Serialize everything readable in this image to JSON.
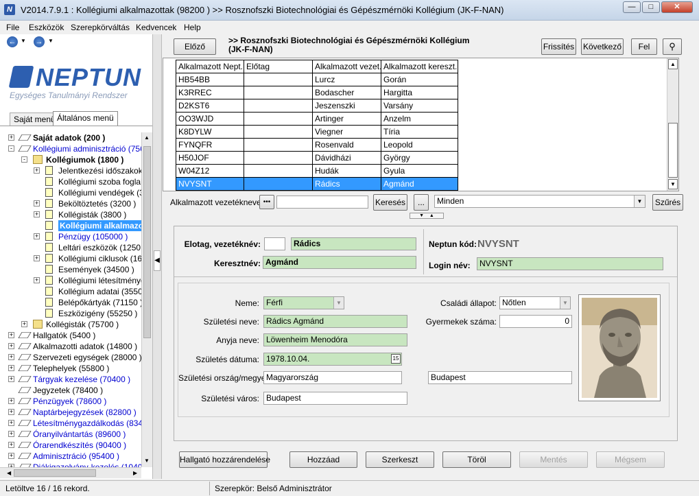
{
  "window": {
    "title": "V2014.7.9.1 : Kollégiumi alkalmazottak (98200  )  >> Rosznofszki Biotechnológiai és Gépészmérnöki Kollégium (JK-F-NAN)",
    "app_icon": "N"
  },
  "menu": [
    "File",
    "Eszközök",
    "Szerepkörváltás",
    "Kedvencek",
    "Help"
  ],
  "logo": {
    "brand": "NEPTUN",
    "subtitle": "Egységes Tanulmányi Rendszer"
  },
  "left_tabs": [
    "Saját menü",
    "Általános menü"
  ],
  "tree": [
    {
      "label": "Saját adatok (200  )",
      "level": 0,
      "icon": "diamond",
      "pm": "+",
      "style": "bold"
    },
    {
      "label": "Kollégiumi adminisztráció (75650",
      "level": 0,
      "icon": "diamond",
      "pm": "-",
      "style": "blue"
    },
    {
      "label": "Kollégiumok (1800  )",
      "level": 1,
      "icon": "folder",
      "pm": "-",
      "style": "bold"
    },
    {
      "label": "Jelentkezési időszakok (2",
      "level": 2,
      "icon": "page",
      "pm": "+",
      "style": ""
    },
    {
      "label": "Kollégiumi szoba foglaltsá",
      "level": 2,
      "icon": "page",
      "pm": "",
      "style": ""
    },
    {
      "label": "Kollégiumi vendégek (315",
      "level": 2,
      "icon": "page",
      "pm": "",
      "style": ""
    },
    {
      "label": "Beköltöztetés (3200  )",
      "level": 2,
      "icon": "page",
      "pm": "+",
      "style": ""
    },
    {
      "label": "Kollégisták (3800  )",
      "level": 2,
      "icon": "page",
      "pm": "+",
      "style": ""
    },
    {
      "label": "Kollégiumi alkalmazot",
      "level": 2,
      "icon": "page",
      "pm": "",
      "style": "selected"
    },
    {
      "label": "Pénzügy (105000  )",
      "level": 2,
      "icon": "page",
      "pm": "+",
      "style": "blue"
    },
    {
      "label": "Leltári eszközök (1250  )",
      "level": 2,
      "icon": "page",
      "pm": "",
      "style": ""
    },
    {
      "label": "Kollégiumi ciklusok (1610",
      "level": 2,
      "icon": "page",
      "pm": "+",
      "style": ""
    },
    {
      "label": "Események (34500  )",
      "level": 2,
      "icon": "page",
      "pm": "",
      "style": ""
    },
    {
      "label": "Kollégiumi létesítménygaz",
      "level": 2,
      "icon": "page",
      "pm": "+",
      "style": ""
    },
    {
      "label": "Kollégium adatai (3550  )",
      "level": 2,
      "icon": "page",
      "pm": "",
      "style": ""
    },
    {
      "label": "Belépőkártyák (71150  )",
      "level": 2,
      "icon": "page",
      "pm": "",
      "style": ""
    },
    {
      "label": "Eszközigény (55250  )",
      "level": 2,
      "icon": "page",
      "pm": "",
      "style": ""
    },
    {
      "label": "Kollégisták (75700  )",
      "level": 1,
      "icon": "folder",
      "pm": "+",
      "style": ""
    },
    {
      "label": "Hallgatók (5400  )",
      "level": 0,
      "icon": "diamond",
      "pm": "+",
      "style": ""
    },
    {
      "label": "Alkalmazotti adatok (14800  )",
      "level": 0,
      "icon": "diamond",
      "pm": "+",
      "style": ""
    },
    {
      "label": "Szervezeti egységek (28000  )",
      "level": 0,
      "icon": "diamond",
      "pm": "+",
      "style": ""
    },
    {
      "label": "Telephelyek (55800  )",
      "level": 0,
      "icon": "diamond",
      "pm": "+",
      "style": ""
    },
    {
      "label": "Tárgyak kezelése (70400  )",
      "level": 0,
      "icon": "diamond",
      "pm": "+",
      "style": "blue"
    },
    {
      "label": "Jegyzetek (78400  )",
      "level": 0,
      "icon": "diamond",
      "pm": "",
      "style": ""
    },
    {
      "label": "Pénzügyek (78600  )",
      "level": 0,
      "icon": "diamond",
      "pm": "+",
      "style": "blue"
    },
    {
      "label": "Naptárbejegyzések (82800  )",
      "level": 0,
      "icon": "diamond",
      "pm": "+",
      "style": "blue"
    },
    {
      "label": "Létesítménygazdálkodás (83400",
      "level": 0,
      "icon": "diamond",
      "pm": "+",
      "style": "blue"
    },
    {
      "label": "Óranyilvántartás (89600  )",
      "level": 0,
      "icon": "diamond",
      "pm": "+",
      "style": "blue"
    },
    {
      "label": "Órarendkészítés (90400  )",
      "level": 0,
      "icon": "diamond",
      "pm": "+",
      "style": "blue"
    },
    {
      "label": "Adminisztráció (95400  )",
      "level": 0,
      "icon": "diamond",
      "pm": "+",
      "style": "blue"
    },
    {
      "label": "Diákigazolvány-kezelés (10400...",
      "level": 0,
      "icon": "diamond",
      "pm": "+",
      "style": "blue"
    }
  ],
  "toolbar": {
    "prev": "Előző",
    "header_title": ">> Rosznofszki Biotechnológiai és Gépészmérnöki Kollégium (JK-F-NAN)",
    "refresh": "Frissítés",
    "next": "Következő",
    "up": "Fel"
  },
  "grid": {
    "columns": [
      "Alkalmazott Nept...",
      "Előtag",
      "Alkalmazott vezet...",
      "Alkalmazott kereszt..."
    ],
    "rows": [
      [
        "HB54BB",
        "",
        "Lurcz",
        "Gorán"
      ],
      [
        "K3RREC",
        "",
        "Bodascher",
        "Hargitta"
      ],
      [
        "D2KST6",
        "",
        "Jeszenszki",
        "Varsány"
      ],
      [
        "OO3WJD",
        "",
        "Artinger",
        "Anzelm"
      ],
      [
        "K8DYLW",
        "",
        "Viegner",
        "Tíria"
      ],
      [
        "FYNQFR",
        "",
        "Rosenvald",
        "Leopold"
      ],
      [
        "H50JOF",
        "",
        "Dávidházi",
        "György"
      ],
      [
        "W04Z12",
        "",
        "Hudák",
        "Gyula"
      ],
      [
        "NVYSNT",
        "",
        "Rádics",
        "Agmánd"
      ]
    ],
    "selected_index": 8
  },
  "search": {
    "label": "Alkalmazott vezetékneve",
    "dots": "•••",
    "value": "",
    "search_btn": "Keresés",
    "ellipsis": "...",
    "filter_value": "Minden",
    "filter_btn": "Szűrés"
  },
  "detail": {
    "prefix_label": "Elotag, vezetéknév:",
    "prefix_value": "",
    "lastname": "Rádics",
    "firstname_label": "Keresztnév:",
    "firstname": "Agmánd",
    "neptun_label": "Neptun kód:",
    "neptun_value": "NVYSNT",
    "login_label": "Login név:",
    "login_value": "NVYSNT",
    "gender_label": "Neme:",
    "gender_value": "Férfi",
    "birthname_label": "Születési neve:",
    "birthname_value": "Rádics Agmánd",
    "mother_label": "Anyja neve:",
    "mother_value": "Löwenheim Menodóra",
    "birthdate_label": "Születés dátuma:",
    "birthdate_value": "1978.10.04.",
    "calendar_day": "15",
    "country_label": "Születési ország/megye:",
    "country_value": "Magyarország",
    "county_value": "Budapest",
    "city_label": "Születési város:",
    "city_value": "Budapest",
    "marital_label": "Családi állapot:",
    "marital_value": "Nőtlen",
    "children_label": "Gyermekek száma:",
    "children_value": "0"
  },
  "actions": {
    "assign": "Hallgató hozzárendelése",
    "add": "Hozzáad",
    "edit": "Szerkeszt",
    "delete": "Töröl",
    "save": "Mentés",
    "cancel": "Mégsem"
  },
  "status": {
    "left": "Letöltve 16 / 16 rekord.",
    "role": "Szerepkör: Belső Adminisztrátor"
  }
}
